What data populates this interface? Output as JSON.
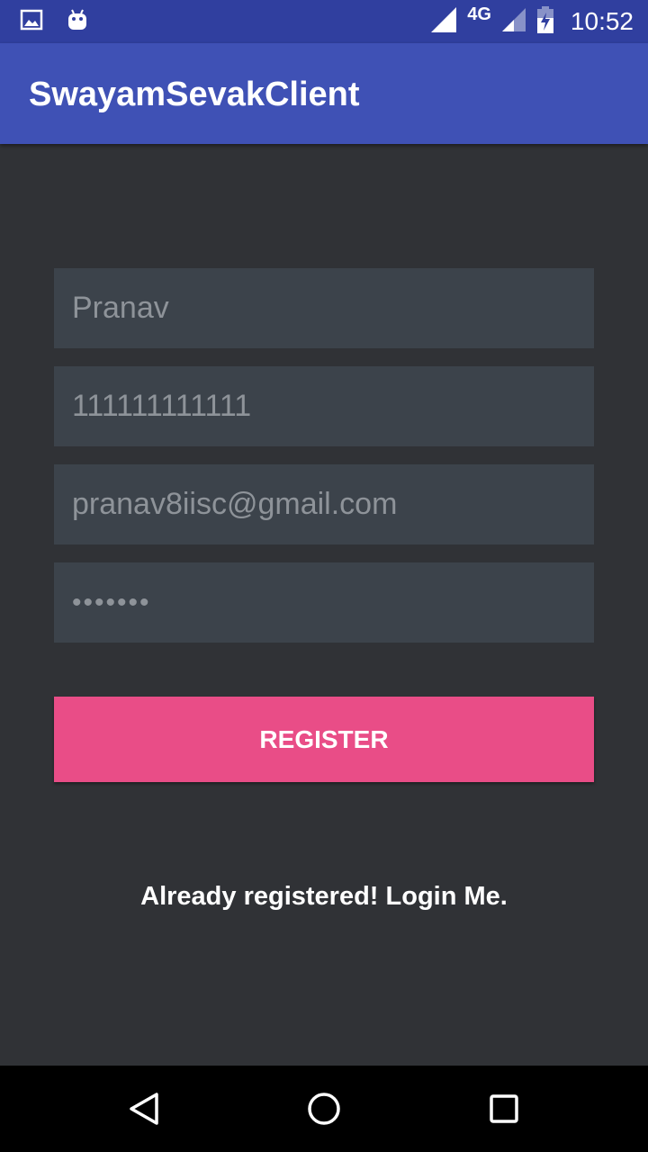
{
  "status_bar": {
    "network_type": "4G",
    "time": "10:52",
    "icons": [
      "image-notification-icon",
      "android-notification-icon",
      "signal-icon",
      "signal-secondary-icon",
      "battery-charging-icon"
    ]
  },
  "app_bar": {
    "title": "SwayamSevakClient"
  },
  "form": {
    "name_value": "Pranav",
    "phone_value": "111111111111",
    "email_value": "pranav8iisc@gmail.com",
    "password_value": "•••••••"
  },
  "register_button": {
    "label": "REGISTER"
  },
  "login_link": {
    "label": "Already registered! Login Me."
  },
  "nav_bar": {
    "icons": [
      "back-icon",
      "home-icon",
      "recents-icon"
    ]
  },
  "colors": {
    "status_bar": "#303f9f",
    "app_bar": "#3f51b5",
    "background": "#303236",
    "field_background": "#3c434b",
    "accent": "#e94d87"
  }
}
